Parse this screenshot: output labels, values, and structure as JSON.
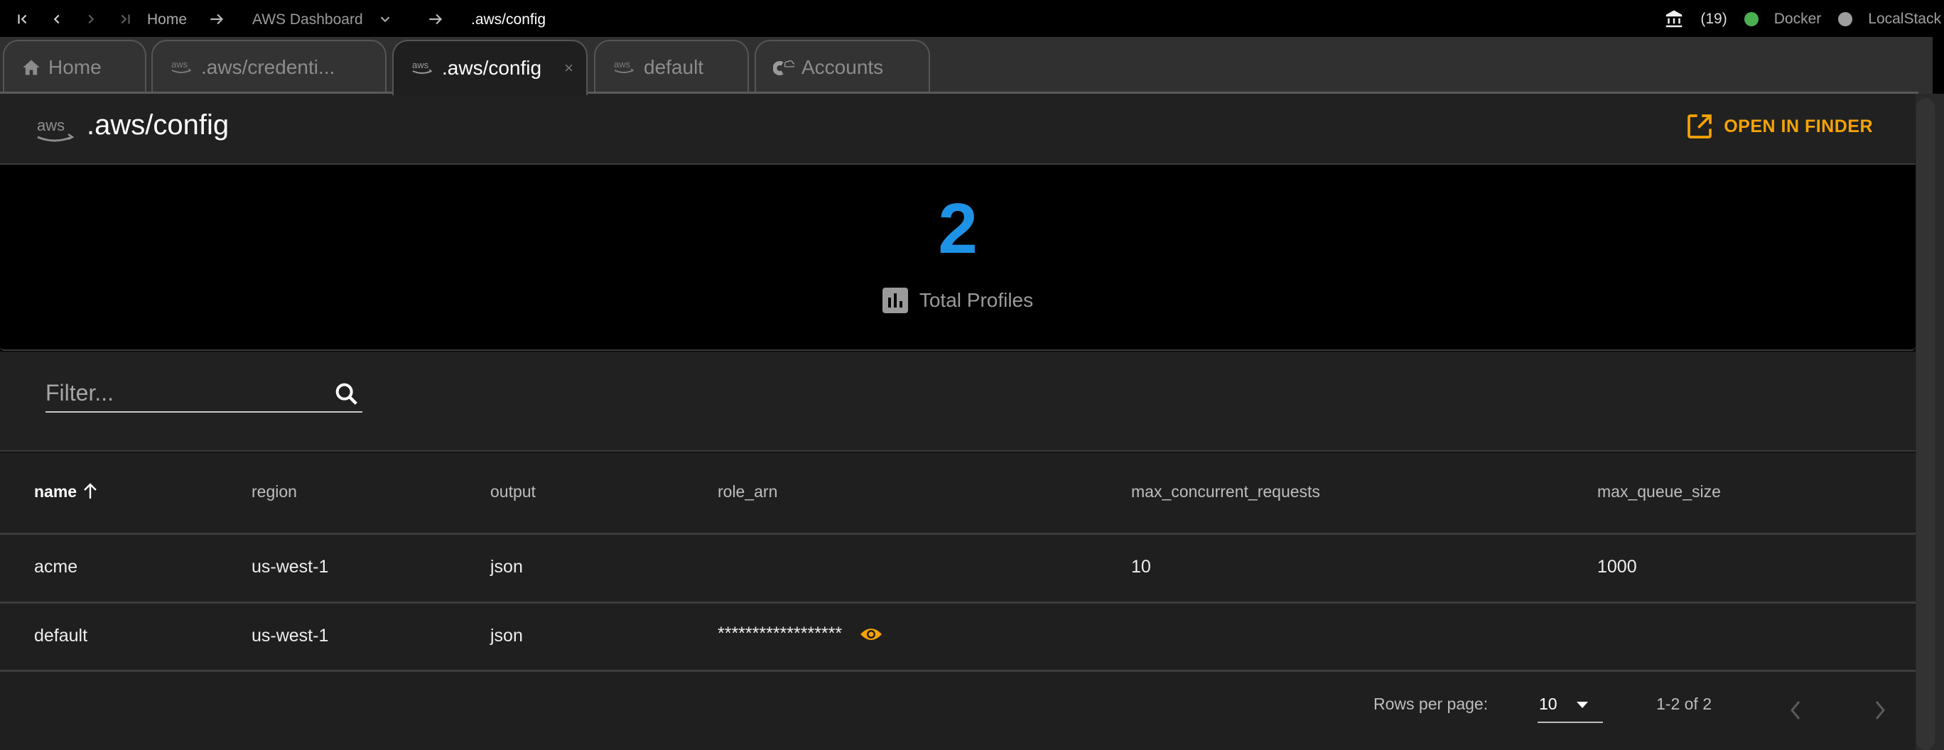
{
  "topbar": {
    "nav": [
      {
        "icon": "first-page-icon",
        "enabled": true
      },
      {
        "icon": "back-icon",
        "enabled": true
      },
      {
        "icon": "forward-icon",
        "enabled": false
      },
      {
        "icon": "last-page-icon",
        "enabled": false
      }
    ],
    "breadcrumb": [
      "Home",
      "AWS Dashboard",
      ".aws/config"
    ],
    "bank_count": "(19)",
    "services": [
      {
        "label": "Docker",
        "status_color": "#4caf50"
      },
      {
        "label": "LocalStack",
        "status_color": "#9e9e9e"
      }
    ]
  },
  "tabs": [
    {
      "label": "Home",
      "icon": "home-icon",
      "active": false
    },
    {
      "label": ".aws/credenti...",
      "icon": "aws-icon",
      "active": false
    },
    {
      "label": ".aws/config",
      "icon": "aws-icon",
      "active": true,
      "close": "×"
    },
    {
      "label": "default",
      "icon": "aws-icon",
      "active": false
    },
    {
      "label": "Accounts",
      "icon": "cloud-accounts-icon",
      "active": false
    }
  ],
  "header": {
    "title": ".aws/config",
    "logo_text": "aws",
    "open_finder_label": "OPEN IN FINDER",
    "accent_color": "#f5a300"
  },
  "stats": {
    "value": "2",
    "label": "Total Profiles",
    "value_color": "#1e93e6"
  },
  "filter": {
    "placeholder": "Filter...",
    "value": ""
  },
  "table": {
    "columns": [
      "name",
      "region",
      "output",
      "role_arn",
      "max_concurrent_requests",
      "max_queue_size"
    ],
    "sort_column": "name",
    "sort_direction": "ascending",
    "rows": [
      {
        "name": "acme",
        "region": "us-west-1",
        "output": "json",
        "role_arn": "",
        "max_concurrent_requests": "10",
        "max_queue_size": "1000"
      },
      {
        "name": "default",
        "region": "us-west-1",
        "output": "json",
        "role_arn": "******************",
        "role_arn_masked": true,
        "max_concurrent_requests": "",
        "max_queue_size": ""
      }
    ]
  },
  "pagination": {
    "rows_per_page_label": "Rows per page:",
    "rows_per_page": "10",
    "range": "1-2 of 2",
    "prev_enabled": false,
    "next_enabled": false
  }
}
